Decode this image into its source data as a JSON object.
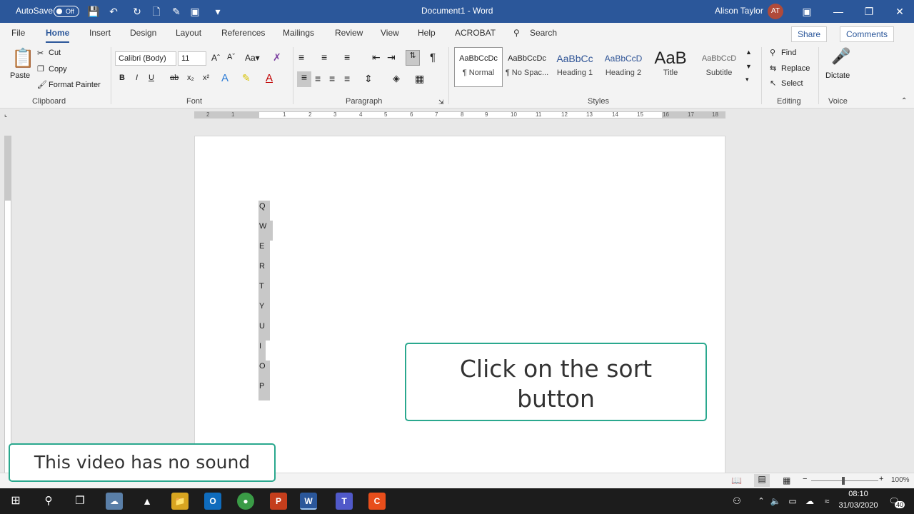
{
  "titlebar": {
    "autosave_label": "AutoSave",
    "autosave_state": "Off",
    "doc_title": "Document1 - Word",
    "user_name": "Alison Taylor",
    "user_initials": "AT",
    "accent": "#2b579a"
  },
  "tabs": [
    "File",
    "Home",
    "Insert",
    "Design",
    "Layout",
    "References",
    "Mailings",
    "Review",
    "View",
    "Help",
    "ACROBAT"
  ],
  "search_label": "Search",
  "share_label": "Share",
  "comments_label": "Comments",
  "clipboard": {
    "paste": "Paste",
    "cut": "Cut",
    "copy": "Copy",
    "format_painter": "Format Painter",
    "group": "Clipboard"
  },
  "font": {
    "name": "Calibri (Body)",
    "size": "11",
    "group": "Font"
  },
  "paragraph": {
    "group": "Paragraph"
  },
  "styles": {
    "group": "Styles",
    "items": [
      {
        "preview": "AaBbCcDc",
        "name": "¶ Normal"
      },
      {
        "preview": "AaBbCcDc",
        "name": "¶ No Spac..."
      },
      {
        "preview": "AaBbCc",
        "name": "Heading 1"
      },
      {
        "preview": "AaBbCcD",
        "name": "Heading 2"
      },
      {
        "preview": "AaB",
        "name": "Title"
      },
      {
        "preview": "AaBbCcD",
        "name": "Subtitle"
      }
    ]
  },
  "editing": {
    "find": "Find",
    "replace": "Replace",
    "select": "Select",
    "group": "Editing"
  },
  "voice": {
    "dictate": "Dictate",
    "group": "Voice"
  },
  "ruler_marks": [
    "2",
    "1",
    "1",
    "2",
    "3",
    "4",
    "5",
    "6",
    "7",
    "8",
    "9",
    "10",
    "11",
    "12",
    "13",
    "14",
    "15",
    "16",
    "17",
    "18"
  ],
  "document": {
    "letters": [
      "Q",
      "W",
      "E",
      "R",
      "T",
      "Y",
      "U",
      "I",
      "O",
      "P"
    ]
  },
  "callouts": {
    "sort": "Click on the sort button",
    "sound": "This video has no sound"
  },
  "statusbar": {
    "zoom": "100%"
  },
  "taskbar": {
    "time": "08:10",
    "date": "31/03/2020",
    "notifications": "40"
  }
}
